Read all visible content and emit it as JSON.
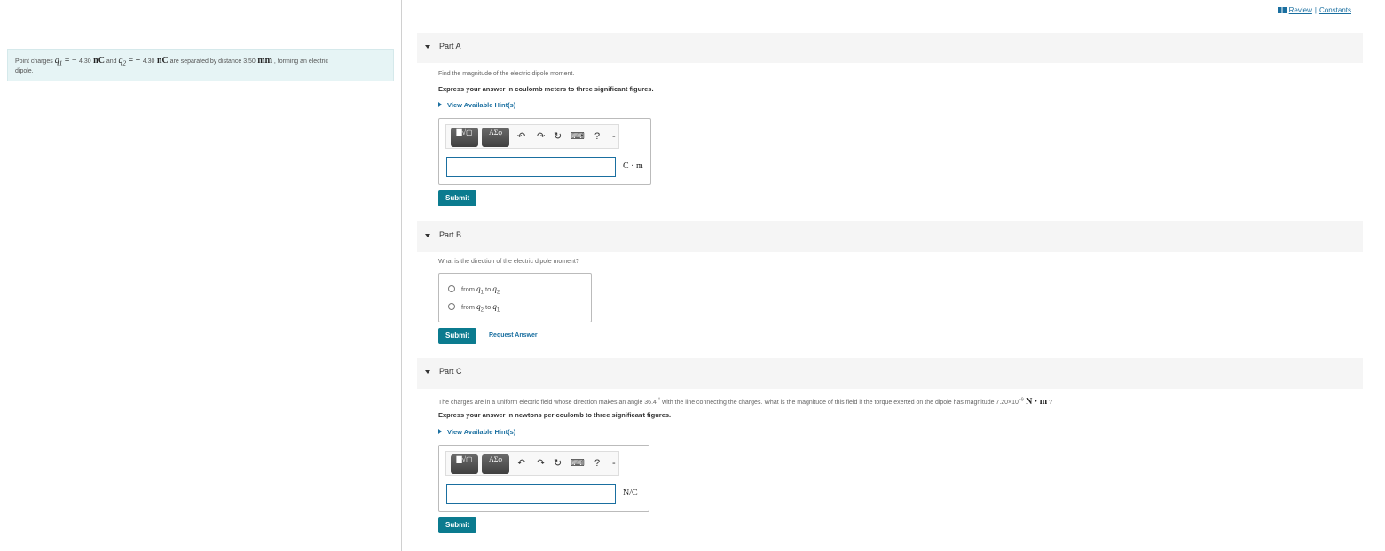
{
  "topbar": {
    "review": "Review",
    "separator": "|",
    "constants": "Constants"
  },
  "problem": {
    "t1": "Point charges ",
    "q1": "q",
    "q1_sub": "1",
    "eq1": " = − ",
    "v1": "4.30",
    "u1": " nC",
    "t2": " and ",
    "q2": "q",
    "q2_sub": "2",
    "eq2": " = + ",
    "v2": "4.30",
    "u2": " nC",
    "t3": " are separated by distance ",
    "d": "3.50",
    "du": " mm",
    "t4": " , forming an electric",
    "t5": "dipole."
  },
  "partA": {
    "title": "Part A",
    "question": "Find the magnitude of the electric dipole moment.",
    "instruction": "Express your answer in coulomb meters to three significant figures.",
    "hint": "View Available Hint(s)",
    "toolbar": {
      "b1": "▇√▢",
      "b2": "ΑΣφ",
      "undo": "↶",
      "redo": "↷",
      "reset": "↻",
      "keyboard": "⌨",
      "help": "?",
      "more": "-"
    },
    "unit": "C · m",
    "submit": "Submit"
  },
  "partB": {
    "title": "Part B",
    "question": "What is the direction of the electric dipole moment?",
    "options": [
      {
        "from": "from ",
        "a": "q",
        "a_sub": "1",
        "to": " to ",
        "b": "q",
        "b_sub": "2"
      },
      {
        "from": "from ",
        "a": "q",
        "a_sub": "2",
        "to": " to ",
        "b": "q",
        "b_sub": "1"
      }
    ],
    "submit": "Submit",
    "request": "Request Answer"
  },
  "partC": {
    "title": "Part C",
    "question_a": "The charges are in a uniform electric field whose direction makes an angle 36.4 ",
    "degree": "°",
    "question_b": " with the line connecting the charges. What is the magnitude of this field if the torque exerted on the dipole has magnitude 7.20×10",
    "exp": "−9",
    "torque_unit": " N · m",
    "question_c": " ?",
    "instruction": "Express your answer in newtons per coulomb to three significant figures.",
    "hint": "View Available Hint(s)",
    "toolbar": {
      "b1": "▇√▢",
      "b2": "ΑΣφ",
      "undo": "↶",
      "redo": "↷",
      "reset": "↻",
      "keyboard": "⌨",
      "help": "?",
      "more": "-"
    },
    "unit": "N/C",
    "submit": "Submit"
  }
}
